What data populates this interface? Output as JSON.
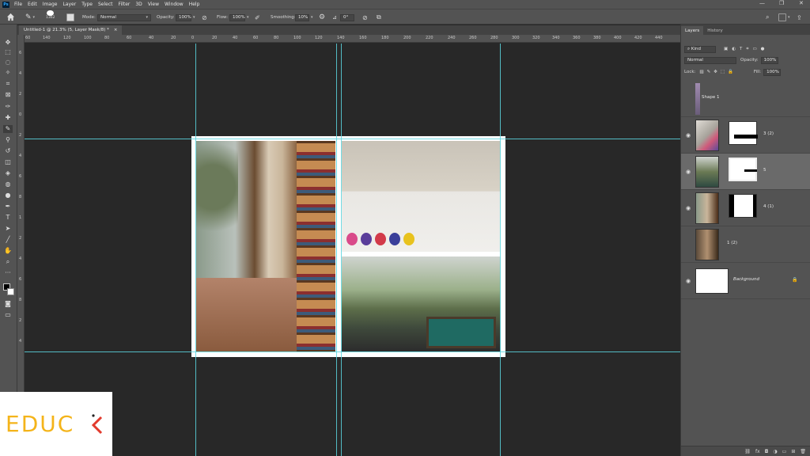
{
  "app": {
    "logo": "Ps"
  },
  "menu": [
    "File",
    "Edit",
    "Image",
    "Layer",
    "Type",
    "Select",
    "Filter",
    "3D",
    "View",
    "Window",
    "Help"
  ],
  "options": {
    "brush_size": "1362",
    "mode_label": "Mode:",
    "mode_value": "Normal",
    "opacity_label": "Opacity:",
    "opacity_value": "100%",
    "flow_label": "Flow:",
    "flow_value": "100%",
    "smoothing_label": "Smoothing:",
    "smoothing_value": "10%",
    "angle_value": "0°"
  },
  "document": {
    "tab_title": "Untitled-1 @ 21.3% (5, Layer Mask/8) *",
    "close": "×"
  },
  "ruler_h": [
    "60",
    "140",
    "120",
    "100",
    "80",
    "60",
    "40",
    "20",
    "0",
    "20",
    "40",
    "60",
    "80",
    "100",
    "120",
    "140",
    "160",
    "180",
    "200",
    "220",
    "240",
    "260",
    "280",
    "300",
    "320",
    "340",
    "360",
    "380",
    "400",
    "420",
    "440"
  ],
  "ruler_v": [
    "6",
    "4",
    "2",
    "0",
    "2",
    "4",
    "6",
    "8",
    "1",
    "2",
    "4",
    "6",
    "8",
    "2",
    "4"
  ],
  "panel": {
    "tabs": [
      "Layers",
      "History"
    ],
    "filter_kind": "Kind",
    "blend_mode": "Normal",
    "opacity_label": "Opacity:",
    "opacity_value": "100%",
    "lock_label": "Lock:",
    "fill_label": "Fill:",
    "fill_value": "100%",
    "layers": [
      {
        "name": "Shape 1",
        "visible": false
      },
      {
        "name": "3 (2)",
        "visible": true
      },
      {
        "name": "5",
        "visible": true,
        "selected": true
      },
      {
        "name": "4 (1)",
        "visible": true
      },
      {
        "name": "1 (2)",
        "visible": false
      },
      {
        "name": "Background",
        "visible": true
      }
    ],
    "bottom_icons": [
      "link-icon",
      "fx-icon",
      "mask-icon",
      "adjustment-icon",
      "group-icon",
      "new-layer-icon",
      "trash-icon"
    ],
    "fx_label": "fx"
  },
  "watermark": {
    "text": "EDUC"
  },
  "colors": {
    "guide": "#5ad6e0",
    "accent_yellow": "#f4b41a",
    "watermark_red": "#e23b2e"
  }
}
